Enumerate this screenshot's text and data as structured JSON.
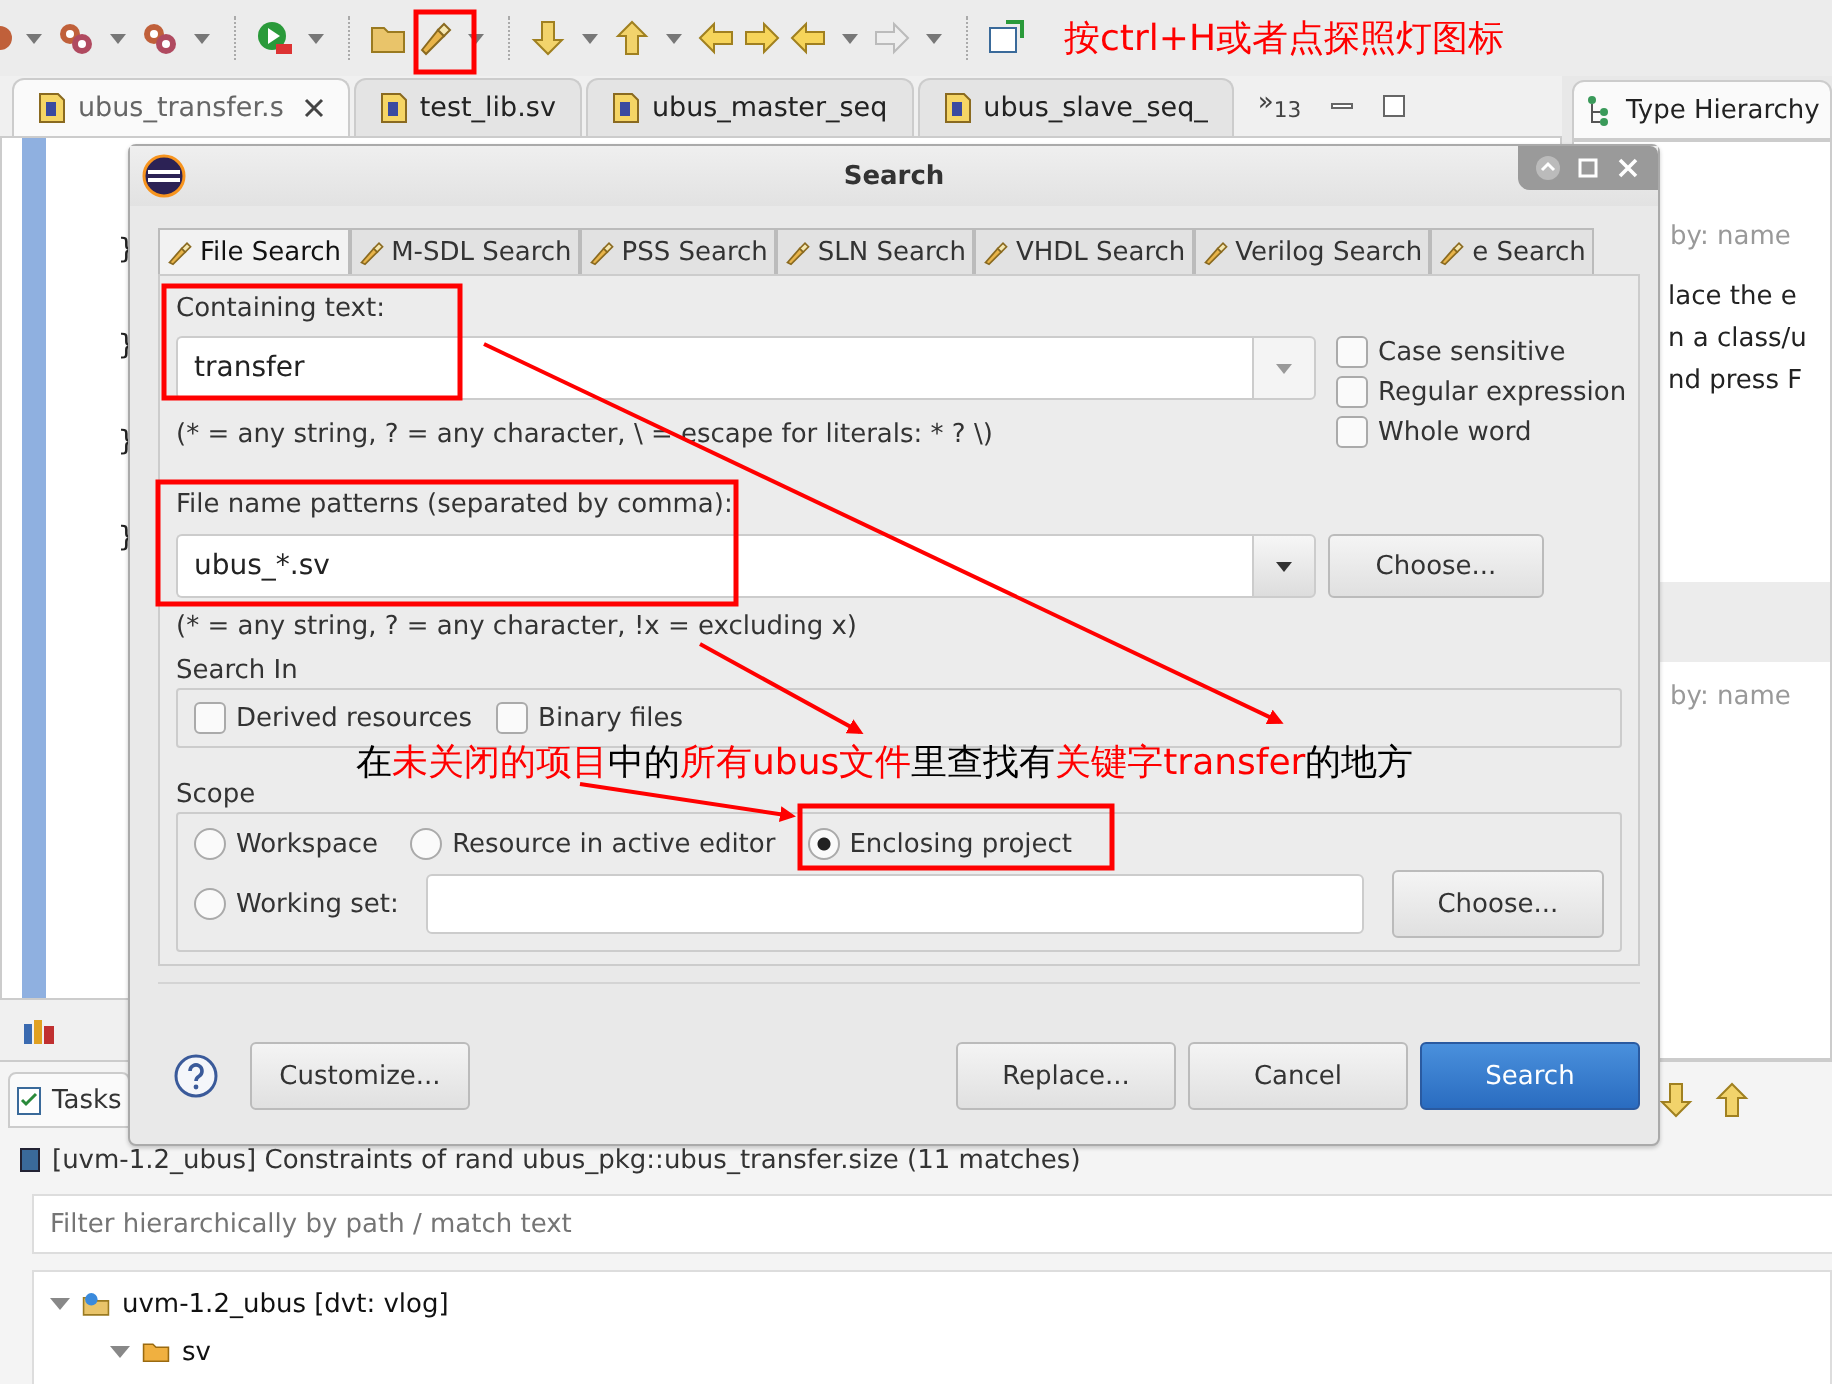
{
  "toolbar": {
    "hint": "按ctrl+H或者点探照灯图标"
  },
  "editor_tabs": [
    {
      "label": "ubus_transfer.s",
      "selected": true
    },
    {
      "label": "test_lib.sv",
      "selected": false
    },
    {
      "label": "ubus_master_seq",
      "selected": false
    },
    {
      "label": "ubus_slave_seq_",
      "selected": false
    }
  ],
  "editor_overflow": "»$_{13}$",
  "editor_code": [
    "}",
    "}",
    "}",
    "}"
  ],
  "type_hierarchy": {
    "title": "Type Hierarchy",
    "filter_placeholder": "by: name",
    "lines": [
      "lace the e",
      "n a class/u",
      "nd press F"
    ],
    "second_filter_placeholder": "by: name"
  },
  "dialog": {
    "title": "Search",
    "tabs": [
      {
        "label": "File Search",
        "selected": true
      },
      {
        "label": "M-SDL Search",
        "selected": false
      },
      {
        "label": "PSS Search",
        "selected": false
      },
      {
        "label": "SLN Search",
        "selected": false
      },
      {
        "label": "VHDL Search",
        "selected": false
      },
      {
        "label": "Verilog Search",
        "selected": false
      },
      {
        "label": "e Search",
        "selected": false
      }
    ],
    "containing_label": "Containing text:",
    "containing_value": "transfer",
    "containing_hint": "(* = any string, ? = any character, \\ = escape for literals: * ? \\)",
    "options": [
      {
        "label": "Case sensitive",
        "checked": false
      },
      {
        "label": "Regular expression",
        "checked": false
      },
      {
        "label": "Whole word",
        "checked": false
      }
    ],
    "patterns_label": "File name patterns (separated by comma):",
    "patterns_value": "ubus_*.sv",
    "patterns_hint": "(* = any string, ? = any character, !x = excluding x)",
    "choose_label": "Choose...",
    "search_in": {
      "label": "Search In",
      "options": [
        {
          "label": "Derived resources",
          "checked": false
        },
        {
          "label": "Binary files",
          "checked": false
        }
      ]
    },
    "scope": {
      "label": "Scope",
      "options": [
        {
          "label": "Workspace",
          "selected": false
        },
        {
          "label": "Resource in active editor",
          "selected": false
        },
        {
          "label": "Enclosing project",
          "selected": true
        },
        {
          "label": "Working set:",
          "selected": false
        }
      ],
      "choose_label": "Choose..."
    },
    "buttons": [
      {
        "label": "Customize...",
        "kind": "left"
      },
      {
        "label": "Replace...",
        "kind": "normal"
      },
      {
        "label": "Cancel",
        "kind": "normal"
      },
      {
        "label": "Search",
        "kind": "default"
      }
    ]
  },
  "note": [
    {
      "text": "在",
      "emphasis": false
    },
    {
      "text": "未关闭的项目",
      "emphasis": true
    },
    {
      "text": "中的",
      "emphasis": false
    },
    {
      "text": "所有ubus文件",
      "emphasis": true
    },
    {
      "text": "里查找有",
      "emphasis": false
    },
    {
      "text": "关键字transfer",
      "emphasis": true
    },
    {
      "text": "的地方",
      "emphasis": false
    }
  ],
  "tasks": {
    "tab": "Tasks",
    "summary": "[uvm-1.2_ubus] Constraints of rand ubus_pkg::ubus_transfer.size (11 matches)",
    "filter_placeholder": "Filter hierarchically by path / match text",
    "tree": [
      {
        "label": "uvm-1.2_ubus [dvt: vlog]",
        "expanded": true,
        "children": [
          {
            "label": "sv",
            "expanded": true
          }
        ]
      }
    ]
  }
}
